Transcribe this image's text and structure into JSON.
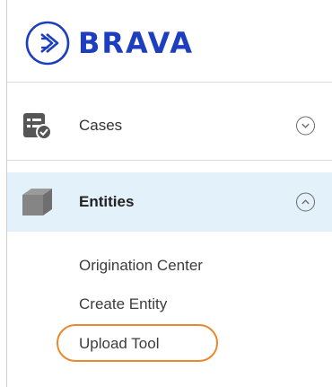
{
  "brand": {
    "name": "BRAVA",
    "color": "#1d3fbf"
  },
  "nav": {
    "items": [
      {
        "label": "Cases",
        "icon": "cases-checklist-icon",
        "expanded": false,
        "active": false
      },
      {
        "label": "Entities",
        "icon": "entities-cube-icon",
        "expanded": true,
        "active": true
      }
    ],
    "entities_sub": [
      {
        "label": "Origination Center"
      },
      {
        "label": "Create Entity"
      },
      {
        "label": "Upload Tool",
        "highlighted": true
      }
    ]
  },
  "colors": {
    "active_bg": "#e3f1fb",
    "highlight": "#e8892b"
  }
}
